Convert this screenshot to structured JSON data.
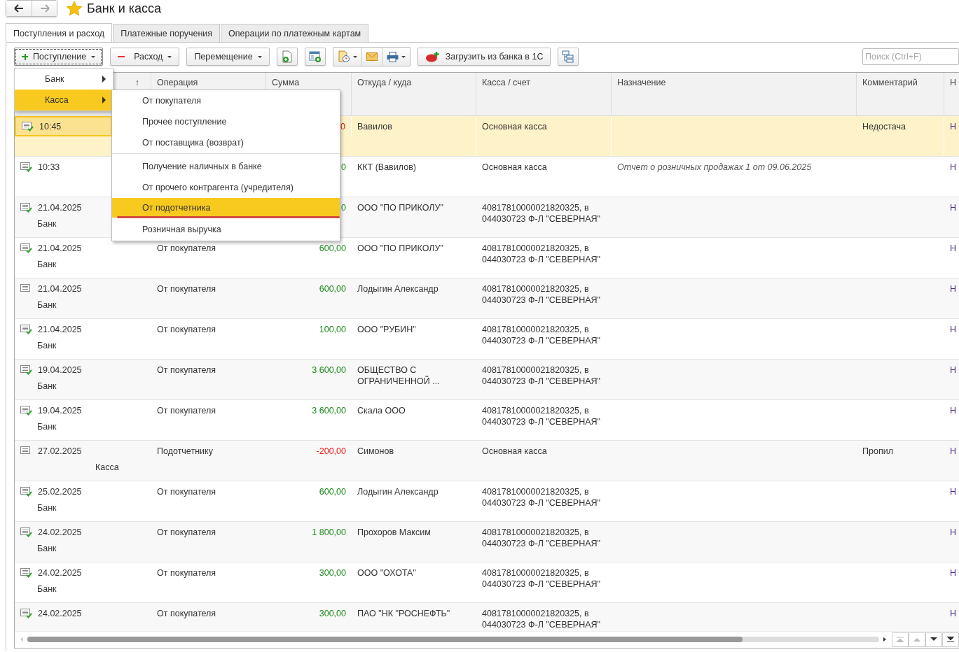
{
  "window": {
    "title": "Банк и касса",
    "favorite": true
  },
  "tabs": [
    {
      "label": "Поступления и расход",
      "selected": true
    },
    {
      "label": "Платежные поручения",
      "selected": false
    },
    {
      "label": "Операции по платежным картам",
      "selected": false
    }
  ],
  "toolbar": {
    "income_button": "Поступление",
    "expense_button": "Расход",
    "transfer_button": "Перемещение",
    "load_button": "Загрузить из банка в 1С",
    "search": {
      "placeholder": "Поиск (Ctrl+F)"
    }
  },
  "menu": {
    "items": [
      {
        "label": "Банк",
        "selected": false
      },
      {
        "label": "Касса",
        "selected": true
      }
    ],
    "submenu": [
      {
        "label": "От покупателя",
        "selected": false,
        "underlined": false,
        "separator_after": false
      },
      {
        "label": "Прочее поступление",
        "selected": false,
        "underlined": false,
        "separator_after": false
      },
      {
        "label": "От поставщика (возврат)",
        "selected": false,
        "underlined": false,
        "separator_after": true
      },
      {
        "label": "Получение наличных в банке",
        "selected": false,
        "underlined": false,
        "separator_after": false
      },
      {
        "label": "От прочего контрагента (учредителя)",
        "selected": false,
        "underlined": false,
        "separator_after": false
      },
      {
        "label": "От подотчетника",
        "selected": true,
        "underlined": true,
        "separator_after": false
      },
      {
        "label": "Розничная выручка",
        "selected": false,
        "underlined": false,
        "separator_after": false
      }
    ]
  },
  "table": {
    "columns": [
      "↑",
      "Операция",
      "Сумма",
      "Откуда / куда",
      "Касса / счет",
      "Назначение",
      "Комментарий",
      "Н"
    ],
    "rows": [
      {
        "selected": true,
        "posted": true,
        "date": "10:45",
        "amount": "0",
        "negative": true,
        "counterparty": "Вавилов",
        "account": "Основная касса",
        "comment": "Недостача",
        "column_9": "Н"
      },
      {
        "selected": false,
        "posted": true,
        "date": "10:33",
        "amount": "0",
        "negative": false,
        "counterparty": "ККТ (Вавилов)",
        "account": "Основная касса",
        "purpose": "Отчет о розничных продажах 1 от 09.06.2025",
        "column_9": "Н"
      },
      {
        "selected": false,
        "posted": true,
        "date": "21.04.2025",
        "type": {
          "text": "Банк",
          "shifted": false
        },
        "amount": "0",
        "negative": false,
        "counterparty": "ООО \"ПО ПРИКОЛУ\"",
        "account": "40817810000021820325, в\n044030723 Ф-Л \"СЕВЕРНАЯ\"",
        "column_9": "Н"
      },
      {
        "selected": false,
        "posted": true,
        "date": "21.04.2025",
        "type": {
          "text": "Банк",
          "shifted": false
        },
        "operation": "От покупателя",
        "amount": "600,00",
        "negative": false,
        "counterparty": "ООО \"ПО ПРИКОЛУ\"",
        "account": "40817810000021820325, в\n044030723 Ф-Л \"СЕВЕРНАЯ\"",
        "column_9": "Н"
      },
      {
        "selected": false,
        "posted": false,
        "date": "21.04.2025",
        "type": {
          "text": "Банк",
          "shifted": false
        },
        "operation": "От покупателя",
        "amount": "600,00",
        "negative": false,
        "counterparty": "Лодыгин Александр",
        "account": "40817810000021820325, в\n044030723 Ф-Л \"СЕВЕРНАЯ\"",
        "column_9": "Н"
      },
      {
        "selected": false,
        "posted": true,
        "date": "21.04.2025",
        "type": {
          "text": "Банк",
          "shifted": false
        },
        "operation": "От покупателя",
        "amount": "100,00",
        "negative": false,
        "counterparty": "ООО \"РУБИН\"",
        "account": "40817810000021820325, в\n044030723 Ф-Л \"СЕВЕРНАЯ\"",
        "column_9": "Н"
      },
      {
        "selected": false,
        "posted": true,
        "date": "19.04.2025",
        "type": {
          "text": "Банк",
          "shifted": false
        },
        "operation": "От покупателя",
        "amount": "3 600,00",
        "negative": false,
        "counterparty": "ОБЩЕСТВО С\nОГРАНИЧЕННОЙ ...",
        "account": "40817810000021820325, в\n044030723 Ф-Л \"СЕВЕРНАЯ\"",
        "column_9": "Н"
      },
      {
        "selected": false,
        "posted": true,
        "date": "19.04.2025",
        "type": {
          "text": "Банк",
          "shifted": false
        },
        "operation": "От покупателя",
        "amount": "3 600,00",
        "negative": false,
        "counterparty": "Скала ООО",
        "account": "40817810000021820325, в\n044030723 Ф-Л \"СЕВЕРНАЯ\"",
        "column_9": "Н"
      },
      {
        "selected": false,
        "posted": false,
        "date": "27.02.2025",
        "type": {
          "text": "Касса",
          "shifted": true
        },
        "operation": "Подотчетнику",
        "amount": "-200,00",
        "negative": true,
        "counterparty": "Симонов",
        "account": "Основная касса",
        "comment": "Пропил",
        "column_9": "Н"
      },
      {
        "selected": false,
        "posted": true,
        "date": "25.02.2025",
        "type": {
          "text": "Банк",
          "shifted": false
        },
        "operation": "От покупателя",
        "amount": "600,00",
        "negative": false,
        "counterparty": "Лодыгин Александр",
        "account": "40817810000021820325, в\n044030723 Ф-Л \"СЕВЕРНАЯ\"",
        "column_9": "Н"
      },
      {
        "selected": false,
        "posted": true,
        "date": "24.02.2025",
        "type": {
          "text": "Банк",
          "shifted": false
        },
        "operation": "От покупателя",
        "amount": "1 800,00",
        "negative": false,
        "counterparty": "Прохоров Максим",
        "account": "40817810000021820325, в\n044030723 Ф-Л \"СЕВЕРНАЯ\"",
        "column_9": "Н"
      },
      {
        "selected": false,
        "posted": true,
        "date": "24.02.2025",
        "type": {
          "text": "Банк",
          "shifted": false
        },
        "operation": "От покупателя",
        "amount": "300,00",
        "negative": false,
        "counterparty": "ООО \"ОХОТА\"",
        "account": "40817810000021820325, в\n044030723 Ф-Л \"СЕВЕРНАЯ\"",
        "column_9": "Н"
      },
      {
        "selected": false,
        "posted": true,
        "date": "24.02.2025",
        "operation": "От покупателя",
        "amount": "300,00",
        "negative": false,
        "counterparty": "ПАО \"НК \"РОСНЕФТЬ\"",
        "account": "40817810000021820325, в\n044030723 Ф-Л \"СЕВЕРНАЯ\"",
        "column_9": "Н"
      }
    ]
  }
}
